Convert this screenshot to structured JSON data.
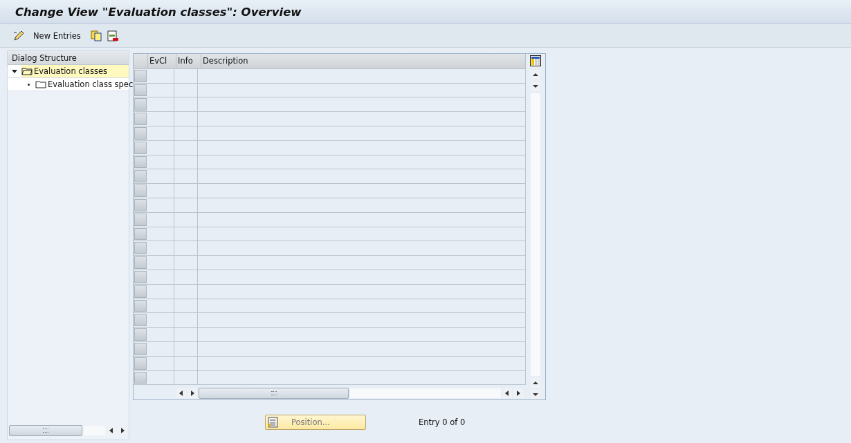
{
  "window": {
    "title": "Change View \"Evaluation classes\": Overview"
  },
  "toolbar": {
    "new_entries": "New Entries"
  },
  "dialog_structure": {
    "title": "Dialog Structure",
    "items": [
      {
        "label": "Evaluation classes",
        "expanded": true,
        "selected": true,
        "children": [
          {
            "label": "Evaluation class spec",
            "selected": false
          }
        ]
      }
    ]
  },
  "table": {
    "columns": [
      "EvCl",
      "Info",
      "Description"
    ]
  },
  "footer": {
    "position_button": "Position...",
    "entry_count": "Entry 0 of 0"
  }
}
